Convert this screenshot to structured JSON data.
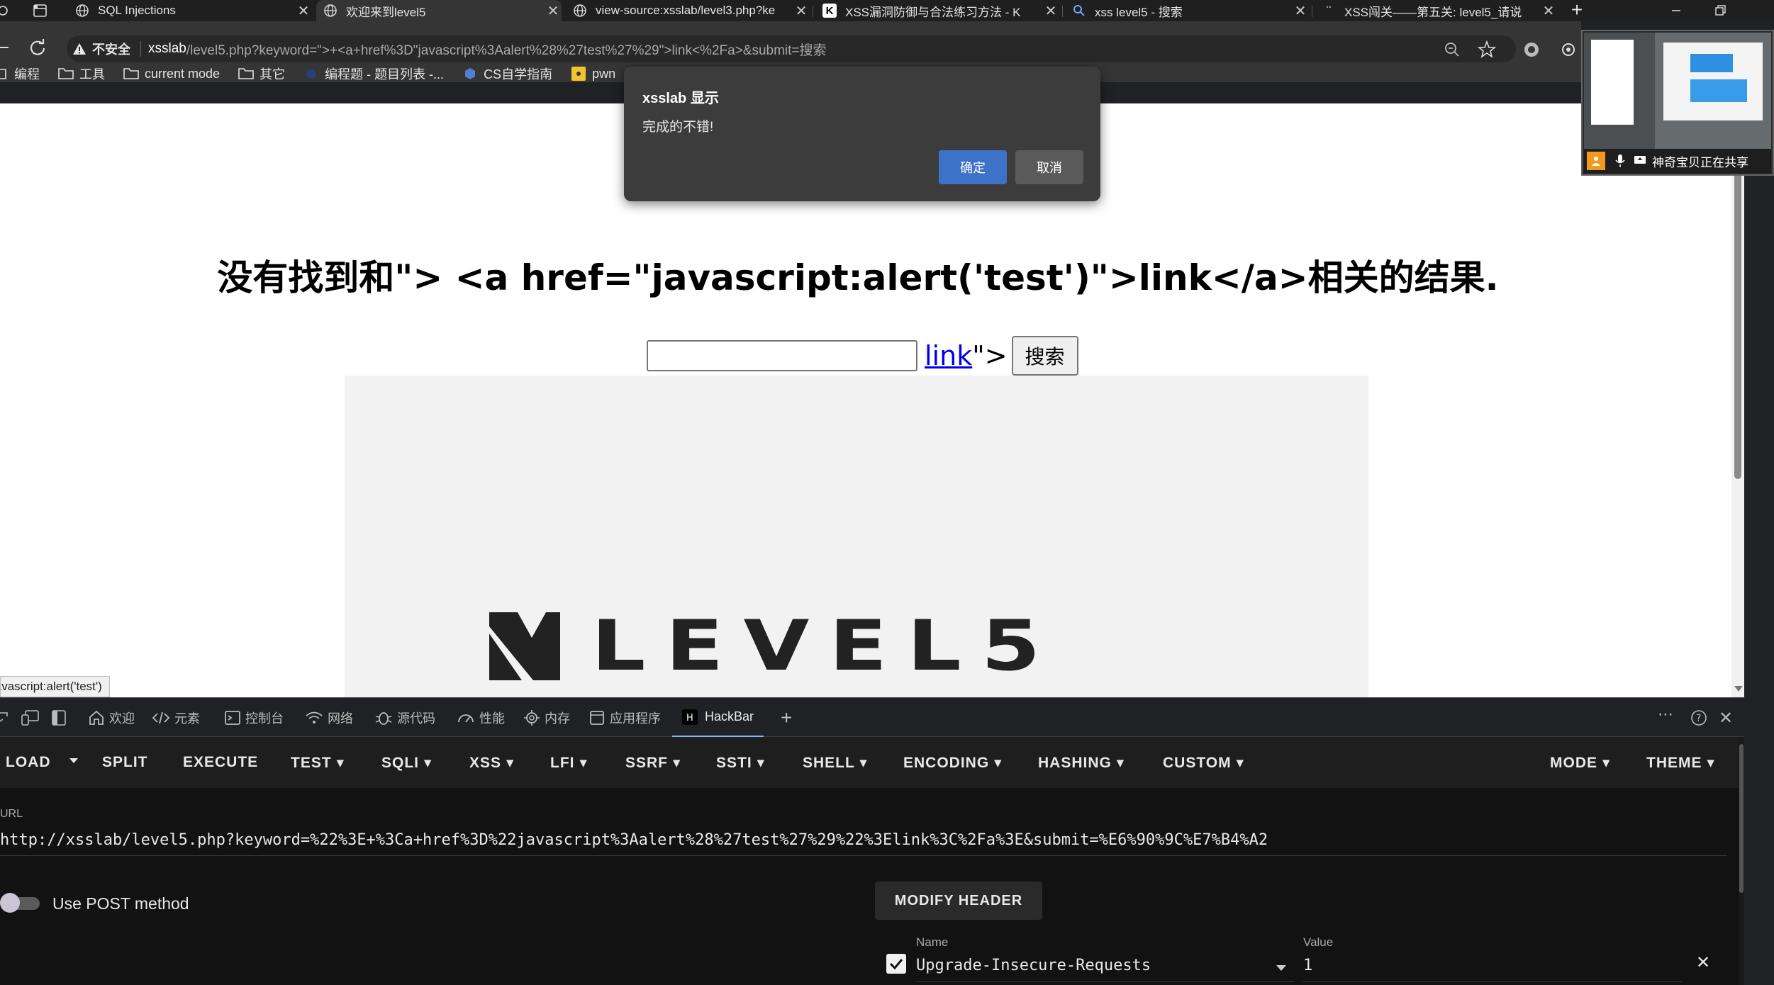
{
  "tabs": [
    {
      "label": "SQL Injections",
      "icon": "globe-icon"
    },
    {
      "label": "欢迎来到level5",
      "icon": "globe-icon"
    },
    {
      "label": "view-source:xsslab/level3.php?ke",
      "icon": "globe-icon"
    },
    {
      "label": "XSS漏洞防御与合法练习方法 - K",
      "icon": "k-icon"
    },
    {
      "label": "xss level5 - 搜索",
      "icon": "search-icon"
    },
    {
      "label": "XSS闯关——第五关: level5_请说",
      "icon": "csdn-icon"
    }
  ],
  "address_bar": {
    "security_label": "不安全",
    "host": "xsslab",
    "path": "/level5.php?keyword=\">+<a+href%3D\"javascript%3Aalert%28%27test%27%29\">link<%2Fa>&submit=搜索"
  },
  "bookmarks": [
    "编程",
    "工具",
    "current mode",
    "其它",
    "编程题 - 题目列表 -...",
    "CS自学指南",
    "pwn"
  ],
  "alert_dialog": {
    "title": "xsslab 显示",
    "message": "完成的不错!",
    "ok_label": "确定",
    "cancel_label": "取消"
  },
  "page": {
    "heading": "没有找到和\"> <a href=\"javascript:alert('test')\">link</a>相关的结果.",
    "search_value": "",
    "link_text": "link",
    "after_link": "\">",
    "search_button": "搜索",
    "logo_text": "LEVEL5"
  },
  "status_tooltip": "javascript:alert('test')",
  "screen_share": {
    "label": "神奇宝贝正在共享"
  },
  "devtools": {
    "tabs": [
      {
        "label": "欢迎",
        "icon": "home-icon"
      },
      {
        "label": "元素",
        "icon": "code-icon"
      },
      {
        "label": "控制台",
        "icon": "console-icon"
      },
      {
        "label": "网络",
        "icon": "wifi-icon"
      },
      {
        "label": "源代码",
        "icon": "bug-icon"
      },
      {
        "label": "性能",
        "icon": "gauge-icon"
      },
      {
        "label": "内存",
        "icon": "memory-icon"
      },
      {
        "label": "应用程序",
        "icon": "app-icon"
      },
      {
        "label": "HackBar",
        "icon": "hackbar-icon"
      }
    ]
  },
  "hackbar": {
    "menu": {
      "load": "LOAD",
      "split": "SPLIT",
      "execute": "EXECUTE",
      "test": "TEST",
      "sqli": "SQLI",
      "xss": "XSS",
      "lfi": "LFI",
      "ssrf": "SSRF",
      "ssti": "SSTI",
      "shell": "SHELL",
      "encoding": "ENCODING",
      "hashing": "HASHING",
      "custom": "CUSTOM",
      "mode": "MODE",
      "theme": "THEME"
    },
    "url_label": "URL",
    "url_value": "http://xsslab/level5.php?keyword=%22%3E+%3Ca+href%3D%22javascript%3Aalert%28%27test%27%29%22%3Elink%3C%2Fa%3E&submit=%E6%90%9C%E7%B4%A2",
    "post_label": "Use POST method",
    "post_enabled": false,
    "modify_header_label": "MODIFY HEADER",
    "header_name_label": "Name",
    "header_value_label": "Value",
    "header_name": "Upgrade-Insecure-Requests",
    "header_value": "1",
    "header_enabled": true
  },
  "colors": {
    "accent_blue": "#3d72c9",
    "hackbar_bg": "#121212",
    "link_blue": "#0000ee"
  }
}
